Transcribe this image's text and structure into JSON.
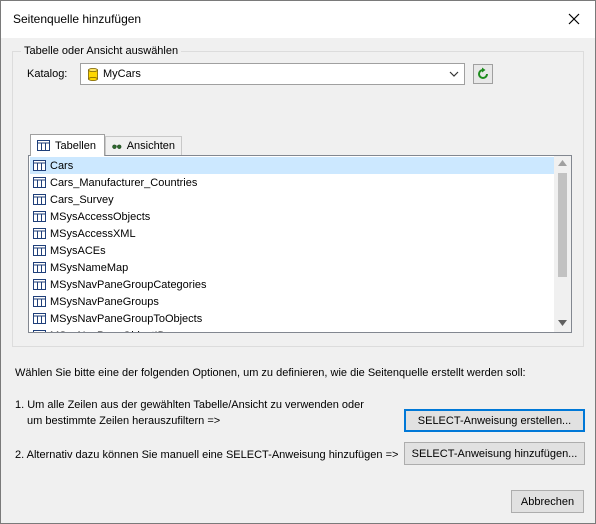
{
  "window": {
    "title": "Seitenquelle hinzufügen"
  },
  "group": {
    "legend": "Tabelle oder Ansicht auswählen"
  },
  "catalog": {
    "label": "Katalog:",
    "value": "MyCars"
  },
  "tabs": [
    {
      "label": "Tabellen",
      "active": true
    },
    {
      "label": "Ansichten",
      "active": false
    }
  ],
  "tables": [
    "Cars",
    "Cars_Manufacturer_Countries",
    "Cars_Survey",
    "MSysAccessObjects",
    "MSysAccessXML",
    "MSysACEs",
    "MSysNameMap",
    "MSysNavPaneGroupCategories",
    "MSysNavPaneGroups",
    "MSysNavPaneGroupToObjects",
    "MSysNavPaneObjectIDs"
  ],
  "selected_index": 0,
  "instructions": {
    "intro": "Wählen Sie bitte eine der folgenden Optionen, um zu definieren, wie die Seitenquelle erstellt werden soll:",
    "option1_line1": "1. Um alle Zeilen aus der gewählten Tabelle/Ansicht zu verwenden oder",
    "option1_line2": "um bestimmte Zeilen herauszufiltern =>",
    "option2": "2. Alternativ dazu können Sie manuell eine SELECT-Anweisung hinzufügen =>"
  },
  "buttons": {
    "create_select": "SELECT-Anweisung erstellen...",
    "add_select": "SELECT-Anweisung hinzufügen...",
    "cancel": "Abbrechen"
  },
  "colors": {
    "selection": "#cce8ff",
    "accent": "#0078d7",
    "db_icon": "#ffd800",
    "refresh_icon": "#1e8c1e"
  }
}
